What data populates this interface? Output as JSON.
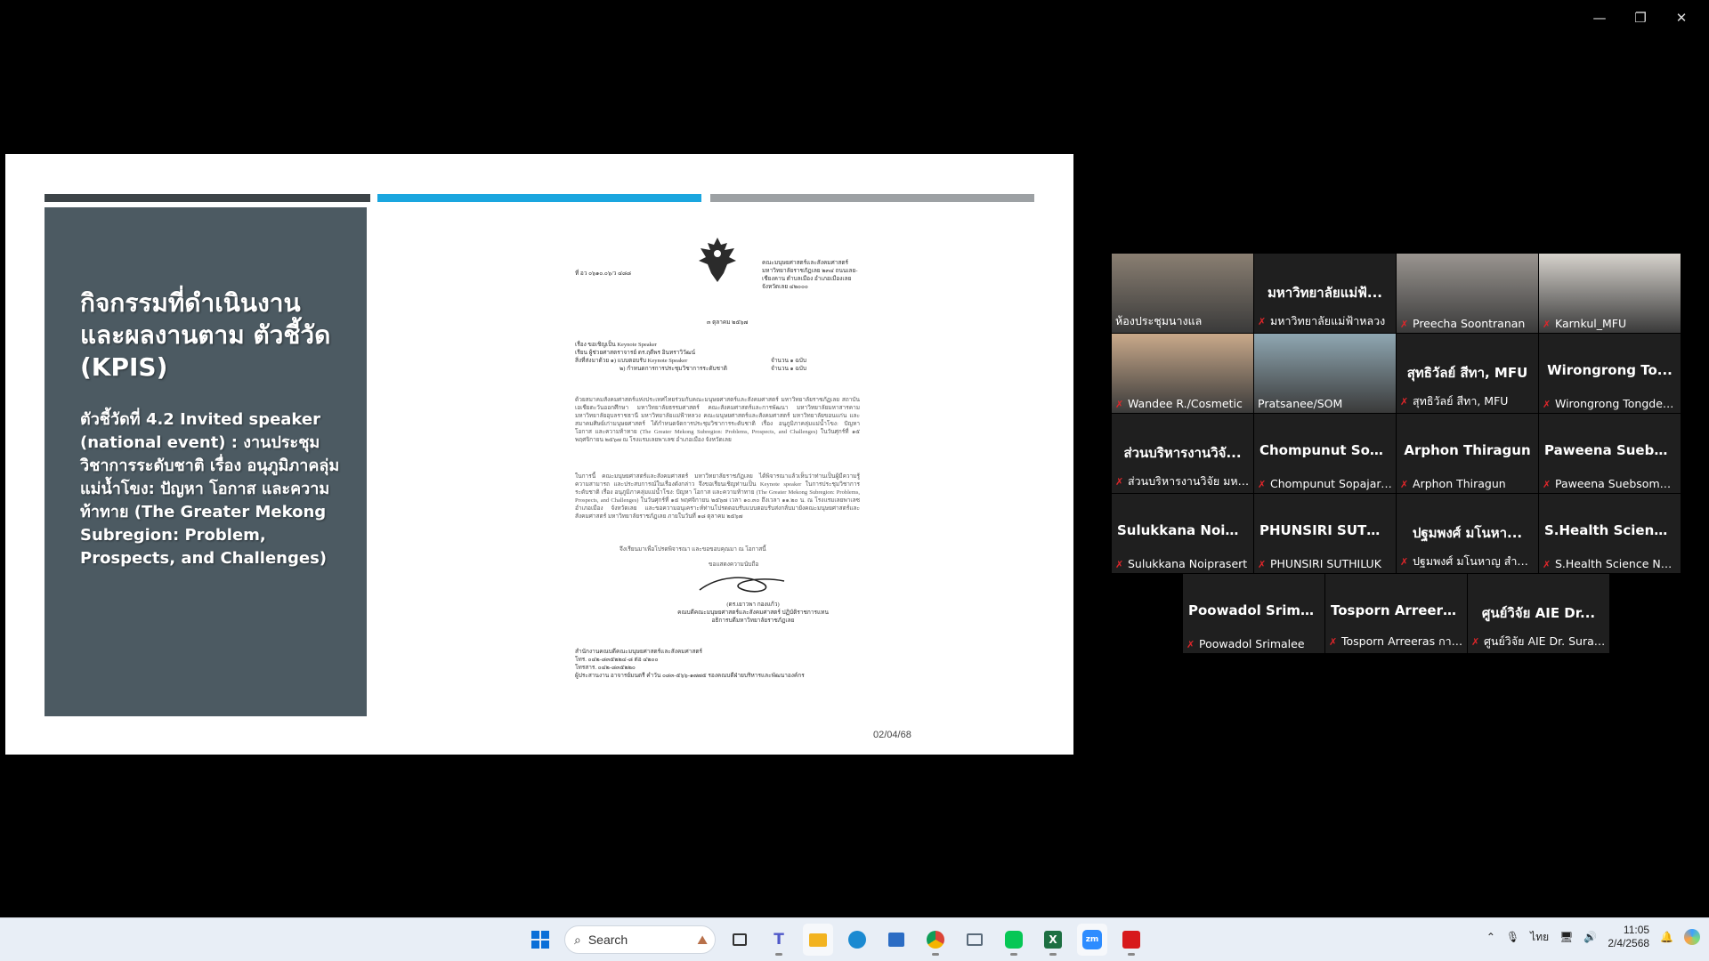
{
  "window": {
    "minimize_glyph": "—",
    "restore_glyph": "❐",
    "close_glyph": "✕"
  },
  "slide": {
    "title": "กิจกรรมที่ดำเนินงาน และผลงานตาม ตัวชี้วัด (KPIS)",
    "body": "ตัวชี้วัดที่ 4.2 Invited speaker (national event) : งานประชุมวิชาการระดับชาติ เรื่อง อนุภูมิภาคลุ่มแม่น้ำโขง: ปัญหา โอกาส และความท้าทาย (The Greater Mekong Subregion: Problem, Prospects, and Challenges)",
    "date": "02/04/68",
    "bar_colors": [
      "#3d4448",
      "#1aa6df",
      "#9da1a4"
    ]
  },
  "document": {
    "ref": "ที่ อว ๐๖๑๐.๐๖/ว ๔๘๘",
    "address": "คณะมนุษยศาสตร์และสังคมศาสตร์ มหาวิทยาลัยราชภัฏเลย ๒๓๔ ถนนเลย-เชียงคาน ตำบลเมือง อำเภอเมืองเลย จังหวัดเลย ๔๒๐๐๐",
    "date": "๓ ตุลาคม ๒๕๖๗",
    "subject": "เรื่อง ขอเชิญเป็น Keynote Speaker",
    "to": "เรียน ผู้ช่วยศาสตราจารย์ ดร.ฤดีพร อินทราวิวัฒน์",
    "enclosure1": "สิ่งที่ส่งมาด้วย ๑) แบบตอบรับ Keynote Speaker",
    "enclosure2": "๒) กำหนดการการประชุมวิชาการระดับชาติ",
    "copies1": "จำนวน ๑ ฉบับ",
    "copies2": "จำนวน ๑ ฉบับ",
    "para1": "ด้วยสมาคมสังคมศาสตร์แห่งประเทศไทยร่วมกับคณะมนุษยศาสตร์และสังคมศาสตร์ มหาวิทยาลัยราชภัฏเลย สถาบันเอเชียตะวันออกศึกษา มหาวิทยาลัยธรรมศาสตร์ คณะสังคมศาสตร์และการพัฒนา มหาวิทยาลัยมหาสารคาม มหาวิทยาลัยอุบลราชธานี มหาวิทยาลัยแม่ฟ้าหลวง คณะมนุษยศาสตร์และสังคมศาสตร์ มหาวิทยาลัยขอนแก่น และสมาคมศิษย์เก่ามนุษยศาสตร์ ได้กำหนดจัดการประชุมวิชาการระดับชาติ เรื่อง อนุภูมิภาคลุ่มแม่น้ำโขง: ปัญหา โอกาส และความท้าทาย (The Greater Mekong Subregion: Problems, Prospects, and Challenges) ในวันศุกร์ที่ ๑๕ พฤศจิกายน ๒๕๖๗ ณ โรงแรมเลยพาเลซ อำเภอเมือง จังหวัดเลย",
    "para2": "ในการนี้ คณะมนุษยศาสตร์และสังคมศาสตร์ มหาวิทยาลัยราชภัฏเลย ได้พิจารณาแล้วเห็นว่าท่านเป็นผู้มีความรู้ ความสามารถ และประสบการณ์ในเรื่องดังกล่าว จึงขอเรียนเชิญท่านเป็น Keynote speaker ในการประชุมวิชาการระดับชาติ เรื่อง อนุภูมิภาคลุ่มแม่น้ำโขง: ปัญหา โอกาส และความท้าทาย (The Greater Mekong Subregion: Problems, Prospects, and Challenges) ในวันศุกร์ที่ ๑๕ พฤศจิกายน ๒๕๖๗ เวลา ๑๐.๓๐ ถึงเวลา ๑๑.๒๐ น. ณ โรงแรมเลยพาเลซ อำเภอเมือง จังหวัดเลย และขอความอนุเคราะห์ท่านโปรดตอบรับแบบตอบรับส่งกลับมายังคณะมนุษยศาสตร์และสังคมศาสตร์ มหาวิทยาลัยราชภัฏเลย ภายในวันที่ ๑๘ ตุลาคม ๒๕๖๗",
    "para3": "จึงเรียนมาเพื่อโปรดพิจารณา และขอขอบคุณมา ณ โอกาสนี้",
    "closing": "ขอแสดงความนับถือ",
    "signer_name": "(ดร.เยาวพา กองแก้ว)",
    "signer_title1": "คณบดีคณะมนุษยศาสตร์และสังคมศาสตร์ ปฏิบัติราชการแทน",
    "signer_title2": "อธิการบดีมหาวิทยาลัยราชภัฏเลย",
    "footer1": "สำนักงานคณบดีคณะมนุษยศาสตร์และสังคมศาสตร์",
    "footer2": "โทร. ๐๔๒-๘๓๕๒๒๔-๘ ต่อ ๔๒๐๐",
    "footer3": "โทรสาร. ๐๔๒-๘๓๕๒๒๐",
    "footer4": "ผู้ประสานงาน อาจารย์มนตรี คำวัน ๐๘๓-๕๖๖-๑๗๗๕ รองคณบดีฝ่ายบริหารและพัฒนาองค์กร"
  },
  "participants": [
    {
      "big": "",
      "label": "ห้องประชุมนางแล",
      "muted": false,
      "video": true,
      "active": false
    },
    {
      "big": "มหาวิทยาลัยแม่ฟ้...",
      "label": "มหาวิทยาลัยแม่ฟ้าหลวง",
      "muted": true,
      "video": false,
      "active": false
    },
    {
      "big": "",
      "label": "Preecha Soontranan",
      "muted": true,
      "video": true,
      "active": false
    },
    {
      "big": "",
      "label": "Karnkul_MFU",
      "muted": true,
      "video": true,
      "active": false
    },
    {
      "big": "",
      "label": "Wandee R./Cosmetic",
      "muted": true,
      "video": true,
      "active": false
    },
    {
      "big": "",
      "label": "Pratsanee/SOM",
      "muted": false,
      "video": true,
      "active": true
    },
    {
      "big": "สุทธิวัลย์ สีทา, MFU",
      "label": "สุทธิวัลย์ สีทา, MFU",
      "muted": true,
      "video": false,
      "active": false
    },
    {
      "big": "Wirongrong To...",
      "label": "Wirongrong Tongdee...",
      "muted": true,
      "video": false,
      "active": false
    },
    {
      "big": "ส่วนบริหารงานวิจั...",
      "label": "ส่วนบริหารงานวิจัย มหาวิ...",
      "muted": true,
      "video": false,
      "active": false
    },
    {
      "big": "Chompunut Sop...",
      "label": "Chompunut Sopajaree",
      "muted": true,
      "video": false,
      "active": false
    },
    {
      "big": "Arphon Thiragun",
      "label": "Arphon Thiragun",
      "muted": true,
      "video": false,
      "active": false
    },
    {
      "big": "Paweena Suebs...",
      "label": "Paweena Suebsombut",
      "muted": true,
      "video": false,
      "active": false
    },
    {
      "big": "Sulukkana Noip...",
      "label": "Sulukkana Noiprasert",
      "muted": true,
      "video": false,
      "active": false
    },
    {
      "big": "PHUNSIRI SUTH...",
      "label": "PHUNSIRI SUTHILUK",
      "muted": true,
      "video": false,
      "active": false
    },
    {
      "big": "ปฐมพงศ์ มโนหา...",
      "label": "ปฐมพงศ์ มโนหาญ สำนัก...",
      "muted": true,
      "video": false,
      "active": false
    },
    {
      "big": "S.Health Science...",
      "label": "S.Health Science Nah...",
      "muted": true,
      "video": false,
      "active": false
    },
    {
      "big": "Poowadol Srima...",
      "label": "Poowadol Srimalee",
      "muted": true,
      "video": false,
      "active": false
    },
    {
      "big": "Tosporn Arreera...",
      "label": "Tosporn Arreeras การ...",
      "muted": true,
      "video": false,
      "active": false
    },
    {
      "big": "ศูนย์วิจัย AIE Dr...",
      "label": "ศูนย์วิจัย AIE Dr. Surap...",
      "muted": true,
      "video": false,
      "active": false
    }
  ],
  "taskbar": {
    "search_placeholder": "Search",
    "language": "ไทย",
    "time": "11:05",
    "date": "2/4/2568",
    "apps": [
      "start-icon",
      "search",
      "task-view-icon",
      "teams-icon",
      "file-explorer-icon",
      "edge-icon",
      "store-icon",
      "chrome-icon",
      "gallery-icon",
      "line-icon",
      "excel-icon",
      "zoom-icon",
      "acrobat-icon"
    ]
  }
}
